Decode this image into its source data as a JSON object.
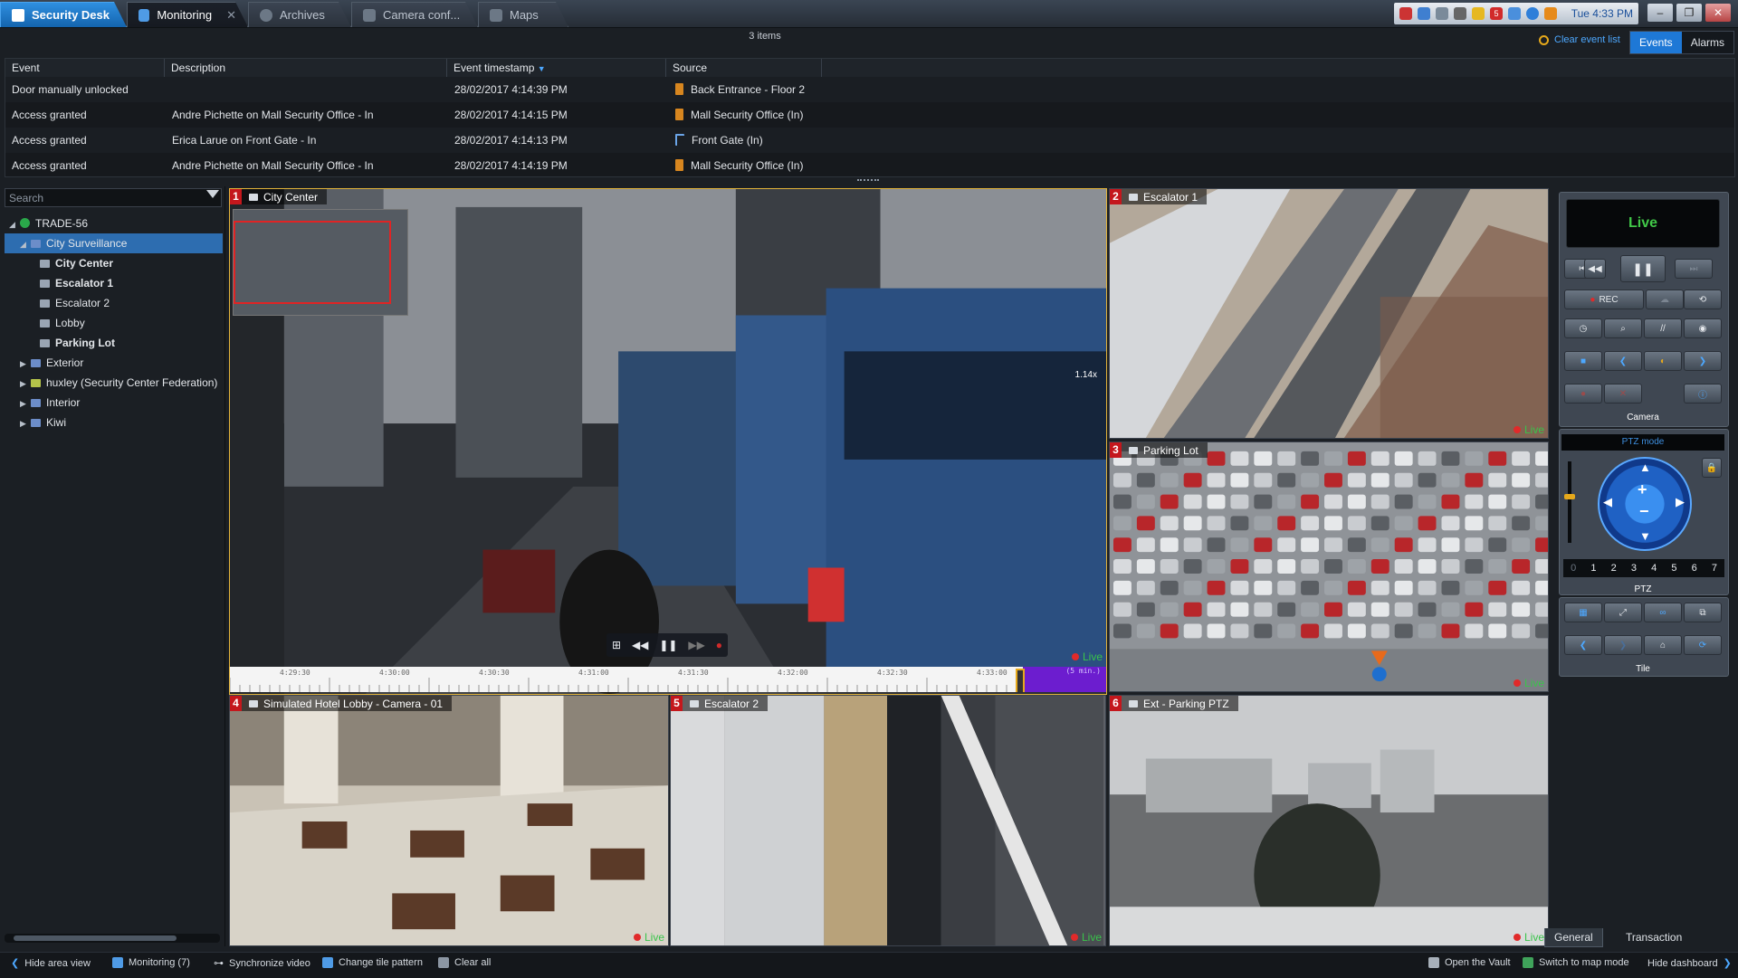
{
  "topbar": {
    "tabs": [
      {
        "label": "Security Desk",
        "icon": "security-desk-icon"
      },
      {
        "label": "Monitoring",
        "icon": "monitoring-icon"
      },
      {
        "label": "Archives",
        "icon": "archives-icon"
      },
      {
        "label": "Camera conf...",
        "icon": "camera-config-icon"
      },
      {
        "label": "Maps",
        "icon": "maps-icon"
      }
    ],
    "tray": {
      "badge": "5",
      "clock": "Tue 4:33 PM"
    },
    "window_buttons": [
      "–",
      "❐",
      "✕"
    ]
  },
  "events": {
    "count_label": "3 items",
    "clear_label": "Clear event list",
    "toggle": {
      "events": "Events",
      "alarms": "Alarms"
    },
    "columns": [
      "Event",
      "Description",
      "Event timestamp",
      "Source"
    ],
    "rows": [
      {
        "event": "Door manually unlocked",
        "description": "",
        "timestamp": "28/02/2017 4:14:39 PM",
        "source": "Back Entrance - Floor 2"
      },
      {
        "event": "Access granted",
        "description": "Andre Pichette on Mall Security Office - In",
        "timestamp": "28/02/2017 4:14:15 PM",
        "source": "Mall Security Office (In)"
      },
      {
        "event": "Access granted",
        "description": "Erica Larue on Front Gate - In",
        "timestamp": "28/02/2017 4:14:13 PM",
        "source": "Front Gate (In)"
      },
      {
        "event": "Access granted",
        "description": "Andre Pichette on Mall Security Office - In",
        "timestamp": "28/02/2017 4:14:19 PM",
        "source": "Mall Security Office (In)"
      }
    ]
  },
  "tree": {
    "search_placeholder": "Search",
    "nodes": [
      {
        "label": "TRADE-56",
        "bold": false
      },
      {
        "label": "City Surveillance",
        "bold": false
      },
      {
        "label": "City Center",
        "bold": true
      },
      {
        "label": "Escalator 1",
        "bold": true
      },
      {
        "label": "Escalator 2",
        "bold": false
      },
      {
        "label": "Lobby",
        "bold": false
      },
      {
        "label": "Parking Lot",
        "bold": true
      },
      {
        "label": "Exterior",
        "bold": false
      },
      {
        "label": "huxley (Security Center Federation)",
        "bold": false
      },
      {
        "label": "Interior",
        "bold": false
      },
      {
        "label": "Kiwi",
        "bold": false
      }
    ]
  },
  "tiles": [
    {
      "num": "1",
      "name": "City Center",
      "zoom": "1.14x",
      "live": "Live"
    },
    {
      "num": "2",
      "name": "Escalator 1",
      "live": "Live"
    },
    {
      "num": "3",
      "name": "Parking Lot",
      "live": "Live"
    },
    {
      "num": "4",
      "name": "Simulated Hotel Lobby - Camera - 01",
      "live": "Live"
    },
    {
      "num": "5",
      "name": "Escalator 2",
      "live": "Live"
    },
    {
      "num": "6",
      "name": "Ext - Parking PTZ",
      "live": "Live"
    }
  ],
  "timeline": {
    "ticks": [
      "4:29:30",
      "4:30:00",
      "4:30:30",
      "4:31:00",
      "4:31:30",
      "4:32:00",
      "4:32:30",
      "4:33:00"
    ],
    "range_label": "(5 min.)"
  },
  "dashboard": {
    "live_label": "Live",
    "rec_label": "REC",
    "camera_label": "Camera",
    "ptz_mode_label": "PTZ mode",
    "presets": [
      "0",
      "1",
      "2",
      "3",
      "4",
      "5",
      "6",
      "7"
    ],
    "ptz_label": "PTZ",
    "tile_label": "Tile",
    "tabs": {
      "general": "General",
      "transaction": "Transaction"
    }
  },
  "bottombar": {
    "hide_area_view": "Hide area view",
    "monitoring": "Monitoring (7)",
    "sync_video": "Synchronize video",
    "change_tile": "Change tile pattern",
    "clear_all": "Clear all",
    "open_vault": "Open the Vault",
    "map_mode": "Switch to map mode",
    "hide_dashboard": "Hide dashboard"
  }
}
